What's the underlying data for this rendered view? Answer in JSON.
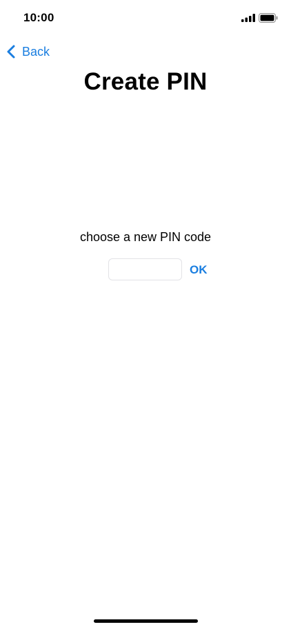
{
  "status_bar": {
    "time": "10:00",
    "signal_icon": "cellular-signal-icon",
    "battery_icon": "battery-full-icon"
  },
  "nav": {
    "back_icon": "chevron-left-icon",
    "back_label": "Back"
  },
  "page": {
    "title": "Create PIN",
    "prompt": "choose a new PIN code"
  },
  "pin_field": {
    "value": "",
    "placeholder": ""
  },
  "ok_button": {
    "label": "OK"
  },
  "colors": {
    "accent": "#1a7ee0",
    "background": "#ffffff",
    "text": "#000000",
    "field_border": "#e2e2e6"
  }
}
